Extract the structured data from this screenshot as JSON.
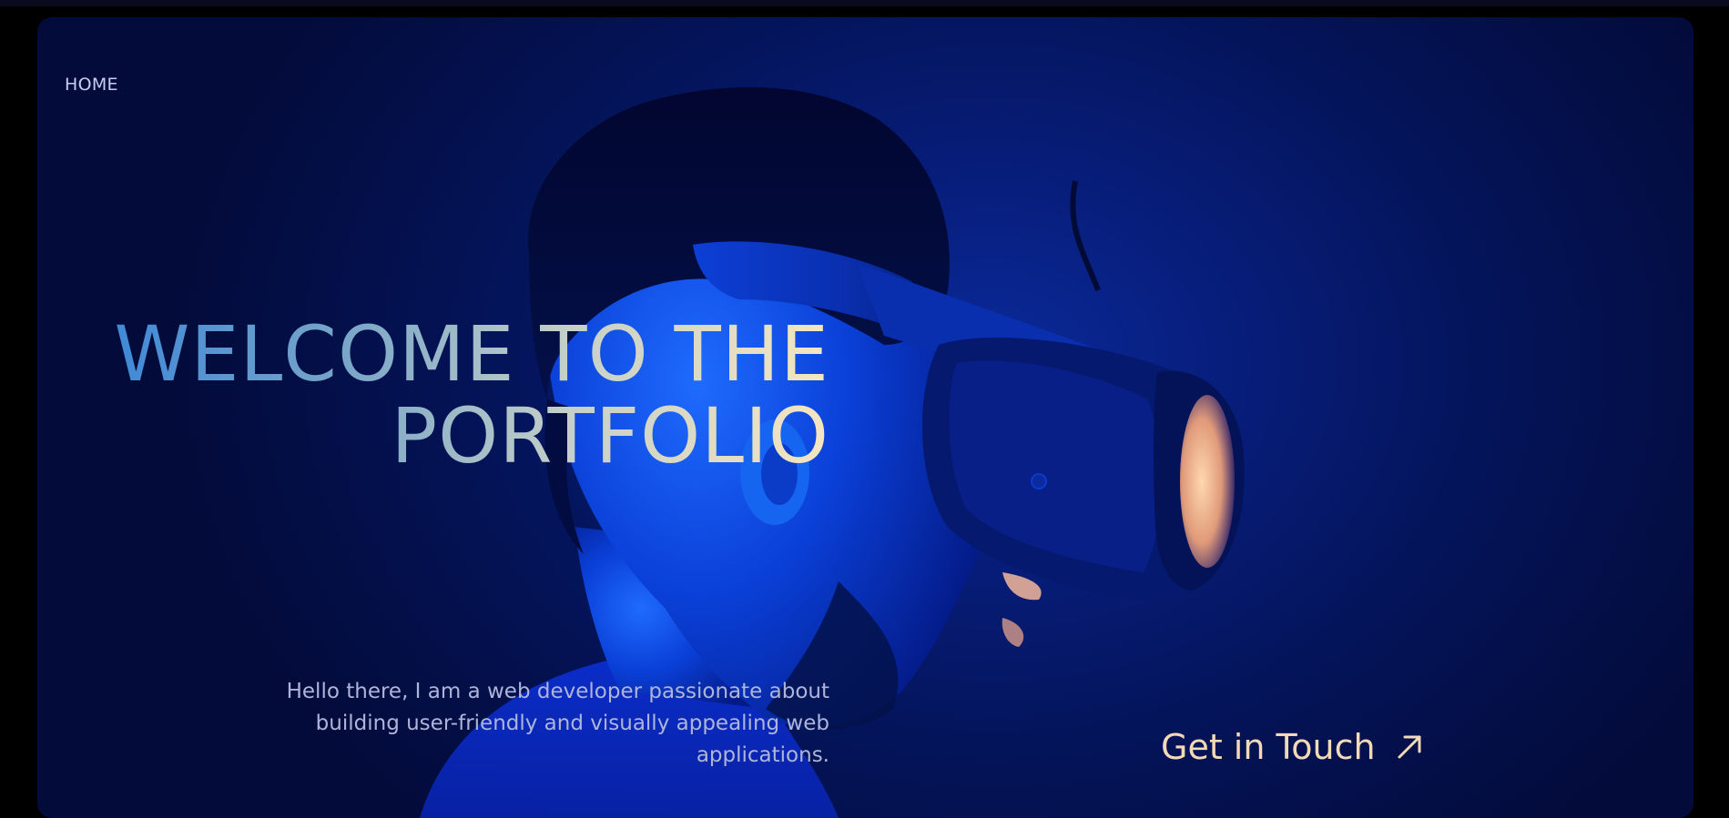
{
  "nav": {
    "home_label": "HOME"
  },
  "hero": {
    "headline_line1": "WELCOME TO THE",
    "headline_line2": "PORTFOLIO",
    "intro_text": "Hello there, I am a web developer passionate about building user-friendly and visually appealing web applications.",
    "cta_label": "Get in Touch",
    "cta_icon": "arrow-up-right-icon",
    "background_image": "person-wearing-vr-headset"
  },
  "colors": {
    "page_background": "#000000",
    "hero_background": "#04145a",
    "headline_gradient_start": "#3a86d8",
    "headline_gradient_end": "#f5e6c0",
    "intro_text": "#aeb5da",
    "cta_text": "#f3d9b5",
    "nav_text": "#c7cdf0"
  }
}
